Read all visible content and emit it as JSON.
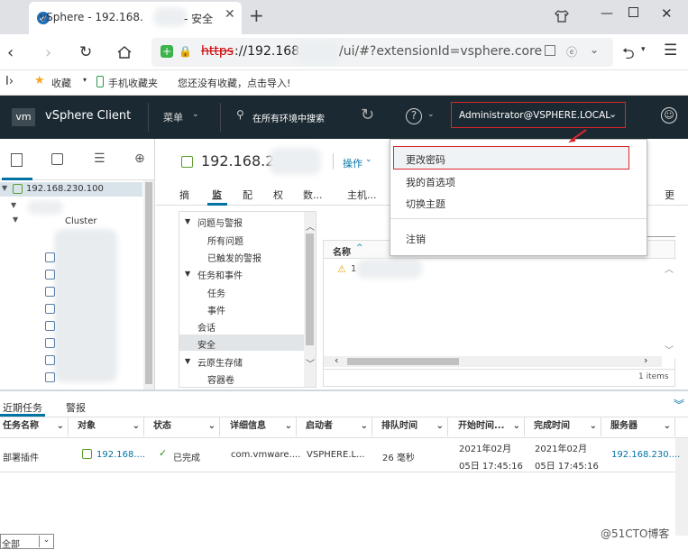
{
  "browser": {
    "tab_title": "vSphere - 192.168.",
    "tab_title_suffix": "- 安全",
    "new_tab": "+",
    "url_https": "https",
    "url_host": "://192.168.",
    "url_path": "/ui/#?extensionId=vsphere.core",
    "bookmarks_label": "收藏",
    "mobile_bookmarks": "手机收藏夹",
    "no_bookmarks": "您还没有收藏，点击导入!"
  },
  "vsphere": {
    "logo": "vm",
    "app_name": "vSphere Client",
    "menu": "菜单",
    "search": "在所有环境中搜索",
    "help": "?",
    "user": "Administrator@VSPHERE.LOCAL",
    "user_menu": [
      "更改密码",
      "我的首选项",
      "切换主题",
      "注销"
    ]
  },
  "tree": {
    "root": "192.168.230.100",
    "cluster": "Cluster"
  },
  "main": {
    "title": "192.168.2",
    "actions": "操作",
    "tabs": [
      "摘",
      "监",
      "配",
      "权",
      "数...",
      "主机...",
      "更"
    ],
    "nav": {
      "group1": "问题与警报",
      "g1_items": [
        "所有问题",
        "已触发的警报"
      ],
      "group2": "任务和事件",
      "g2_items": [
        "任务",
        "事件"
      ],
      "sessions": "会话",
      "security": "安全",
      "group3": "云原生存储",
      "g3_items": [
        "容器卷"
      ]
    },
    "grid_col": "名称",
    "grid_row": "1",
    "items_count": "1 items"
  },
  "bottom": {
    "tabs": [
      "近期任务",
      "警报"
    ],
    "columns": [
      "任务名称",
      "对象",
      "状态",
      "详细信息",
      "启动者",
      "排队时间",
      "开始时间...",
      "完成时间",
      "服务器"
    ],
    "row": {
      "task": "部署插件",
      "object": "192.168....",
      "status": "已完成",
      "details": "com.vmware....",
      "initiator": "VSPHERE.L...",
      "queue": "26 毫秒",
      "start_date": "2021年02月",
      "start_time": "05日 17:45:16",
      "end_date": "2021年02月",
      "end_time": "05日 17:45:16",
      "server": "192.168.230...."
    },
    "filter": "全部",
    "watermark": "@51CTO博客"
  }
}
